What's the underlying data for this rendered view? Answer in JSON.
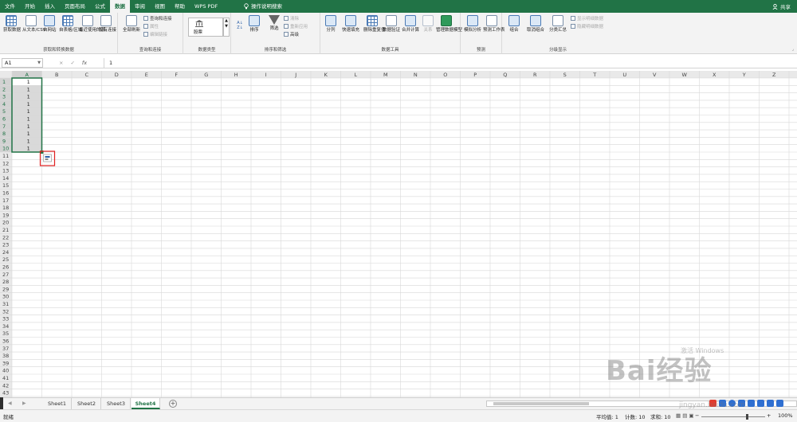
{
  "ribbon_tabs": [
    "文件",
    "开始",
    "插入",
    "页面布局",
    "公式",
    "数据",
    "审阅",
    "视图",
    "帮助",
    "WPS PDF"
  ],
  "active_tab": "数据",
  "tell_me": "操作说明搜索",
  "share": "共享",
  "groups": {
    "get_data": {
      "label": "获取和转换数据",
      "buttons": [
        "获取数据",
        "从文本/CSV",
        "自网站",
        "自表格/区域",
        "最近使用的源",
        "现有连接"
      ]
    },
    "queries": {
      "label": "查询和连接",
      "refresh": "全部刷新",
      "items": [
        "查询和连接",
        "属性",
        "编辑链接"
      ]
    },
    "data_types": {
      "label": "数据类型",
      "item": "股票"
    },
    "sort_filter": {
      "label": "排序和筛选",
      "sort": "排序",
      "filter": "筛选",
      "items": [
        "清除",
        "重新应用",
        "高级"
      ]
    },
    "data_tools": {
      "label": "数据工具",
      "buttons": [
        "分列",
        "快速填充",
        "删除重复值",
        "数据验证",
        "合并计算",
        "关系",
        "管理数据模型"
      ]
    },
    "forecast": {
      "label": "预测",
      "buttons": [
        "模拟分析",
        "预测工作表"
      ]
    },
    "outline": {
      "label": "分级显示",
      "buttons": [
        "组合",
        "取消组合",
        "分类汇总"
      ],
      "items": [
        "显示明细数据",
        "隐藏明细数据"
      ]
    }
  },
  "formula_bar": {
    "name_box": "A1",
    "cancel": "×",
    "enter": "✓",
    "fx": "fx",
    "value": "1"
  },
  "grid": {
    "columns": [
      "A",
      "B",
      "C",
      "D",
      "E",
      "F",
      "G",
      "H",
      "I",
      "J",
      "K",
      "L",
      "M",
      "N",
      "O",
      "P",
      "Q",
      "R",
      "S",
      "T",
      "U",
      "V",
      "W",
      "X",
      "Y",
      "Z"
    ],
    "row_count": 43,
    "selected_range": "A1:A10",
    "cells": {
      "A1": "1",
      "A2": "1",
      "A3": "1",
      "A4": "1",
      "A5": "1",
      "A6": "1",
      "A7": "1",
      "A8": "1",
      "A9": "1",
      "A10": "1"
    }
  },
  "sheets": [
    "Sheet1",
    "Sheet2",
    "Sheet3",
    "Sheet4"
  ],
  "active_sheet": "Sheet4",
  "status": {
    "ready": "就绪",
    "average": "平均值: 1",
    "count": "计数: 10",
    "sum": "求和: 10",
    "zoom": "100%"
  },
  "watermark": {
    "text": "Bai经验",
    "activate": "激活 Windows",
    "url": "jingyan.baidu.com"
  },
  "colors": {
    "accent": "#217346",
    "selection": "#217346",
    "highlight_box": "#e02020"
  }
}
